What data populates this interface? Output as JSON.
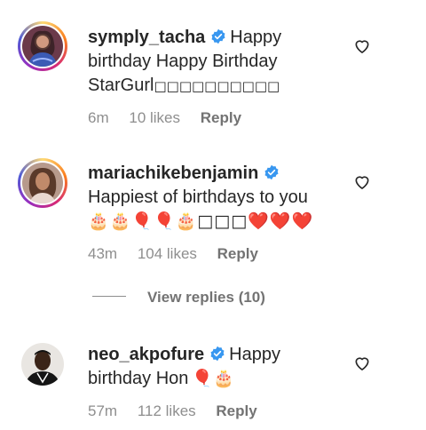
{
  "comments": [
    {
      "username": "symply_tacha",
      "text": "Happy birthday Happy Birthday StarGurl",
      "emoji_tail": "□□□□□□□□□□",
      "time": "6m",
      "likes": "10 likes",
      "reply": "Reply"
    },
    {
      "username": "mariachikebenjamin",
      "text": "Happiest of birthdays to you",
      "emoji_tail": "🎂🎂🎈🎈🎂□□□❤️❤️❤️",
      "time": "43m",
      "likes": "104 likes",
      "reply": "Reply"
    },
    {
      "username": "neo_akpofure",
      "text": "Happy birthday Hon",
      "emoji_tail": "🎈🎂",
      "time": "57m",
      "likes": "112 likes",
      "reply": "Reply"
    }
  ],
  "view_replies": "View replies (10)",
  "colors": {
    "verified": "#3897f0",
    "meta_text": "#8e8e8e",
    "heart_balloon": "#e53935"
  },
  "icons": [
    "verified-badge-icon",
    "heart-outline-icon",
    "birthday-cake-emoji",
    "balloon-emoji",
    "red-heart-emoji"
  ]
}
